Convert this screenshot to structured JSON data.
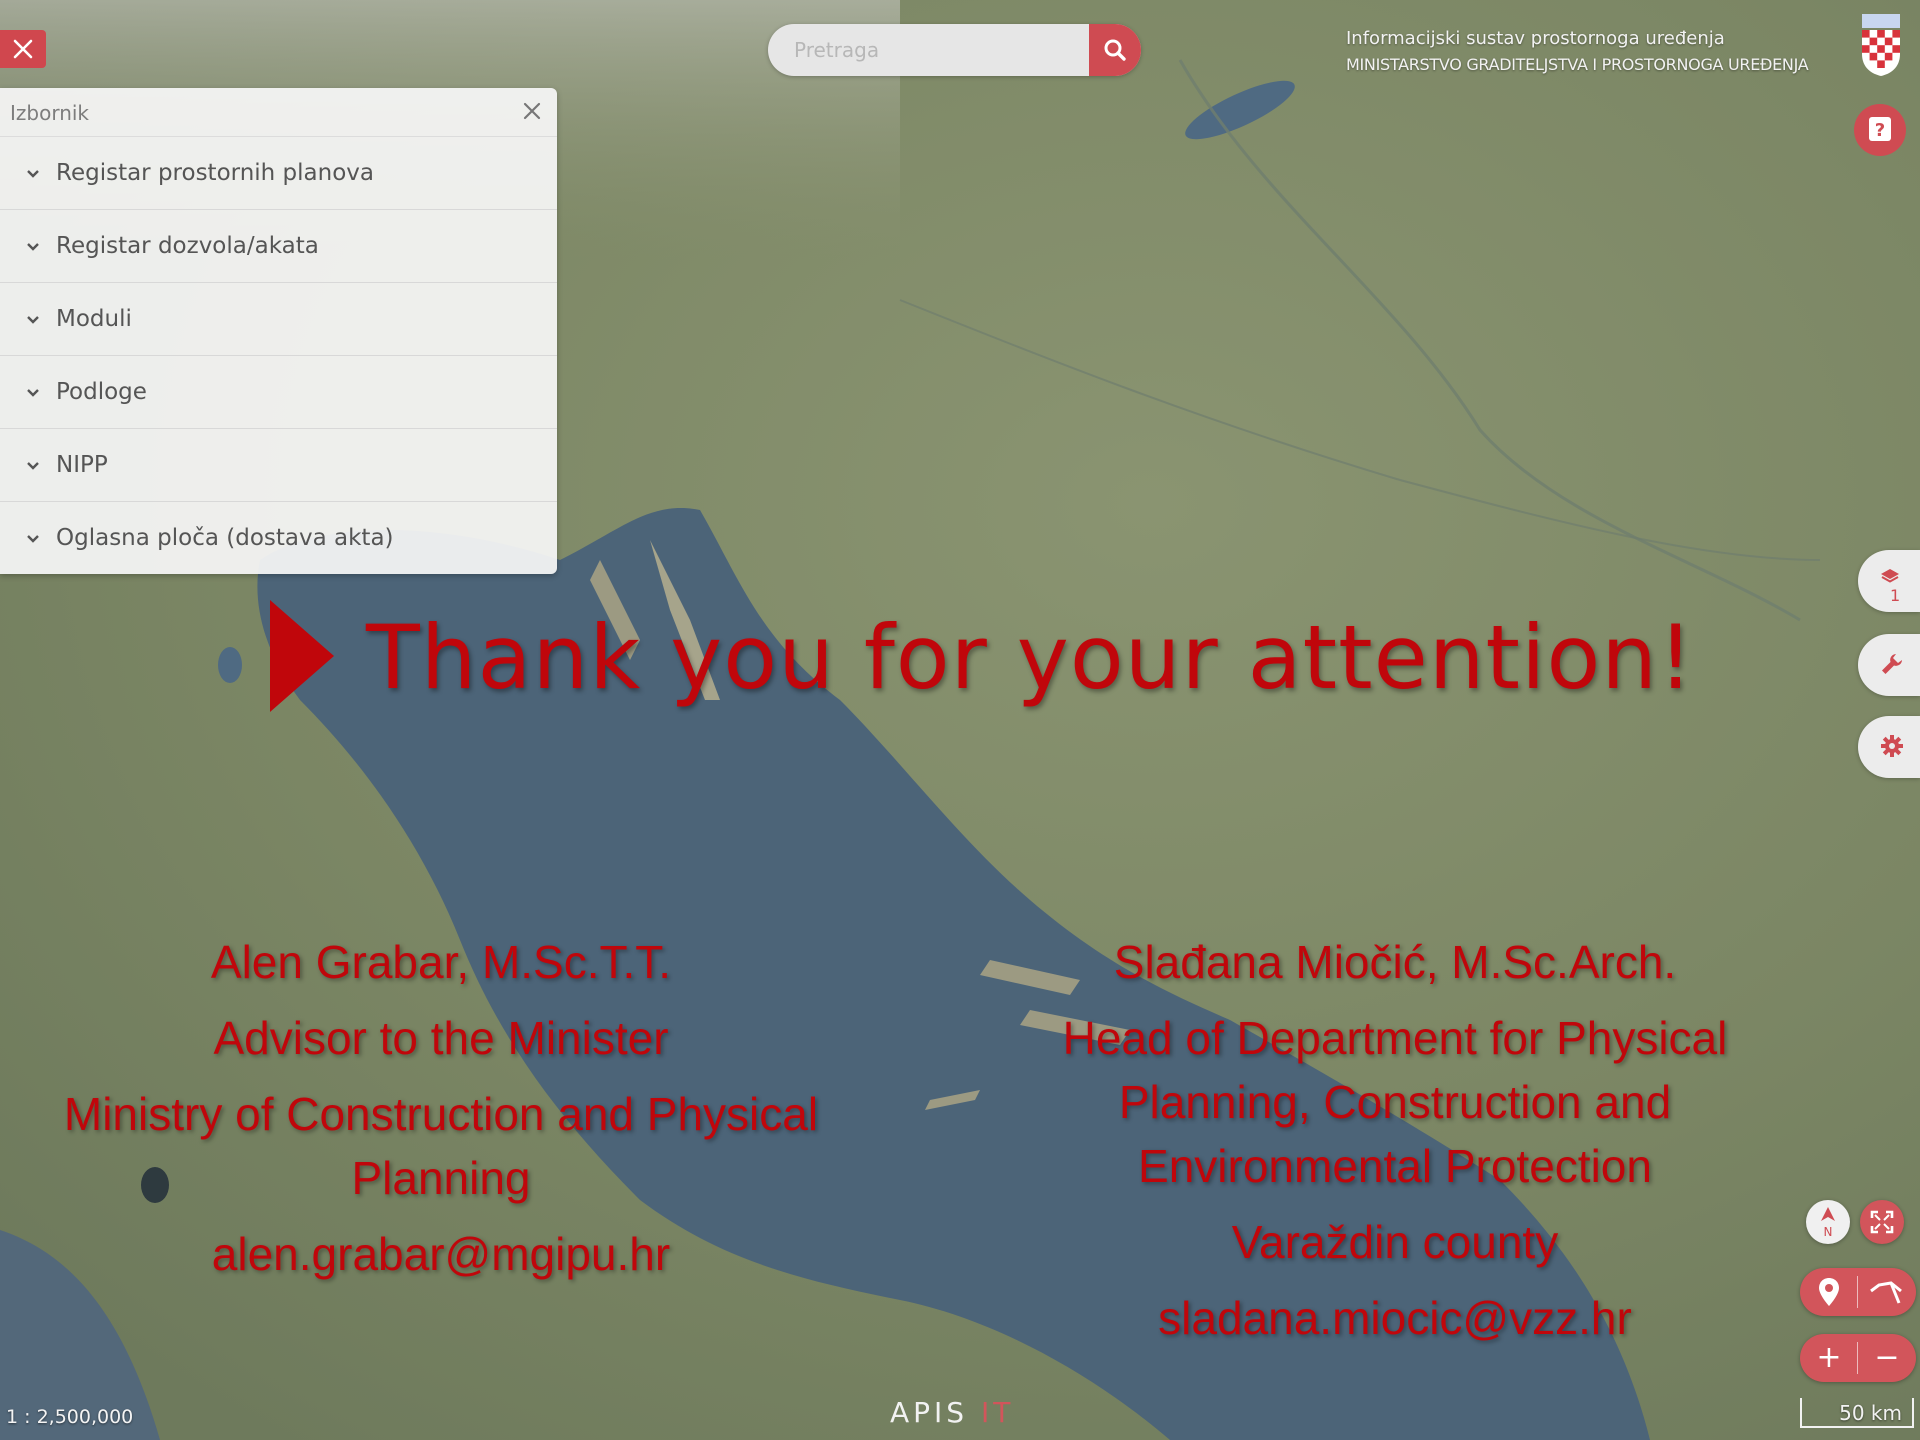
{
  "search": {
    "placeholder": "Pretraga"
  },
  "header": {
    "system_title": "Informacijski sustav prostornoga uređenja",
    "ministry": "MINISTARSTVO GRADITELJSTVA I PROSTORNOGA UREĐENJA"
  },
  "menu": {
    "title": "Izbornik",
    "items": [
      {
        "label": "Registar prostornih planova"
      },
      {
        "label": "Registar dozvola/akata"
      },
      {
        "label": "Moduli"
      },
      {
        "label": "Podloge"
      },
      {
        "label": "NIPP"
      },
      {
        "label": "Oglasna ploča (dostava akta)"
      }
    ]
  },
  "side": {
    "layers_count": "1"
  },
  "slide": {
    "heading": "Thank you for your attention!",
    "left": {
      "name": "Alen Grabar, M.Sc.T.T.",
      "role": "Advisor to the Minister",
      "org_line1": "Ministry of Construction and Physical",
      "org_line2": "Planning",
      "email": "alen.grabar@mgipu.hr"
    },
    "right": {
      "name": "Slađana Miočić, M.Sc.Arch.",
      "role_line1": "Head of Department for Physical",
      "role_line2": "Planning, Construction and",
      "role_line3": "Environmental Protection",
      "org": "Varaždin county",
      "email": "sladana.miocic@vzz.hr"
    }
  },
  "map": {
    "scale_ratio": "1 : 2,500,000",
    "scale_bar": "50 km",
    "zoom_in": "+",
    "zoom_out": "−",
    "compass_letter": "N"
  },
  "footer": {
    "logo_main": "APIS",
    "logo_suffix": "IT"
  },
  "colors": {
    "accent": "#cf4b52",
    "slide_text": "#c0060b",
    "sea": "#4c6478",
    "land": "#7f8a6a"
  },
  "icons": [
    "close-icon",
    "search-icon",
    "help-icon",
    "chevron-down-icon",
    "layers-icon",
    "wrench-icon",
    "gear-icon",
    "compass-icon",
    "fullscreen-icon",
    "location-pin-icon",
    "measure-icon",
    "play-triangle-icon",
    "coat-of-arms-icon"
  ]
}
